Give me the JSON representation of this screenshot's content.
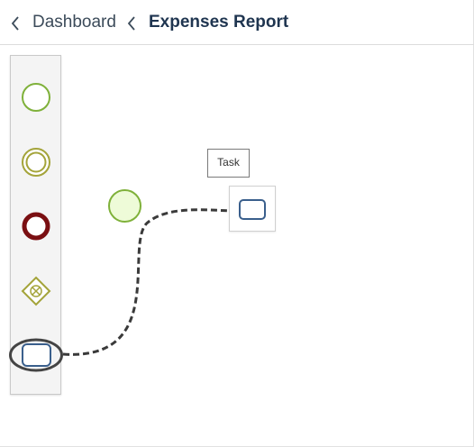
{
  "header": {
    "back_icon": "chevron-left-icon",
    "breadcrumb": [
      {
        "label": "Dashboard"
      },
      {
        "label": "Expenses Report"
      }
    ]
  },
  "palette": {
    "items": [
      {
        "name": "start-event",
        "icon": "circle-icon",
        "color": "#7fb13a"
      },
      {
        "name": "intermediate-event",
        "icon": "double-circle-icon",
        "color": "#a4a43a"
      },
      {
        "name": "end-event",
        "icon": "thick-circle-icon",
        "color": "#7a0f12"
      },
      {
        "name": "exclusive-gateway",
        "icon": "gateway-x-icon",
        "color": "#a4a43a"
      },
      {
        "name": "task",
        "icon": "rounded-rect-icon",
        "color": "#3a5f8c",
        "selected": true
      }
    ]
  },
  "canvas": {
    "tooltip_label": "Task",
    "start_event_fill": "#eefbd8",
    "connector_style": "dashed-arrow"
  }
}
